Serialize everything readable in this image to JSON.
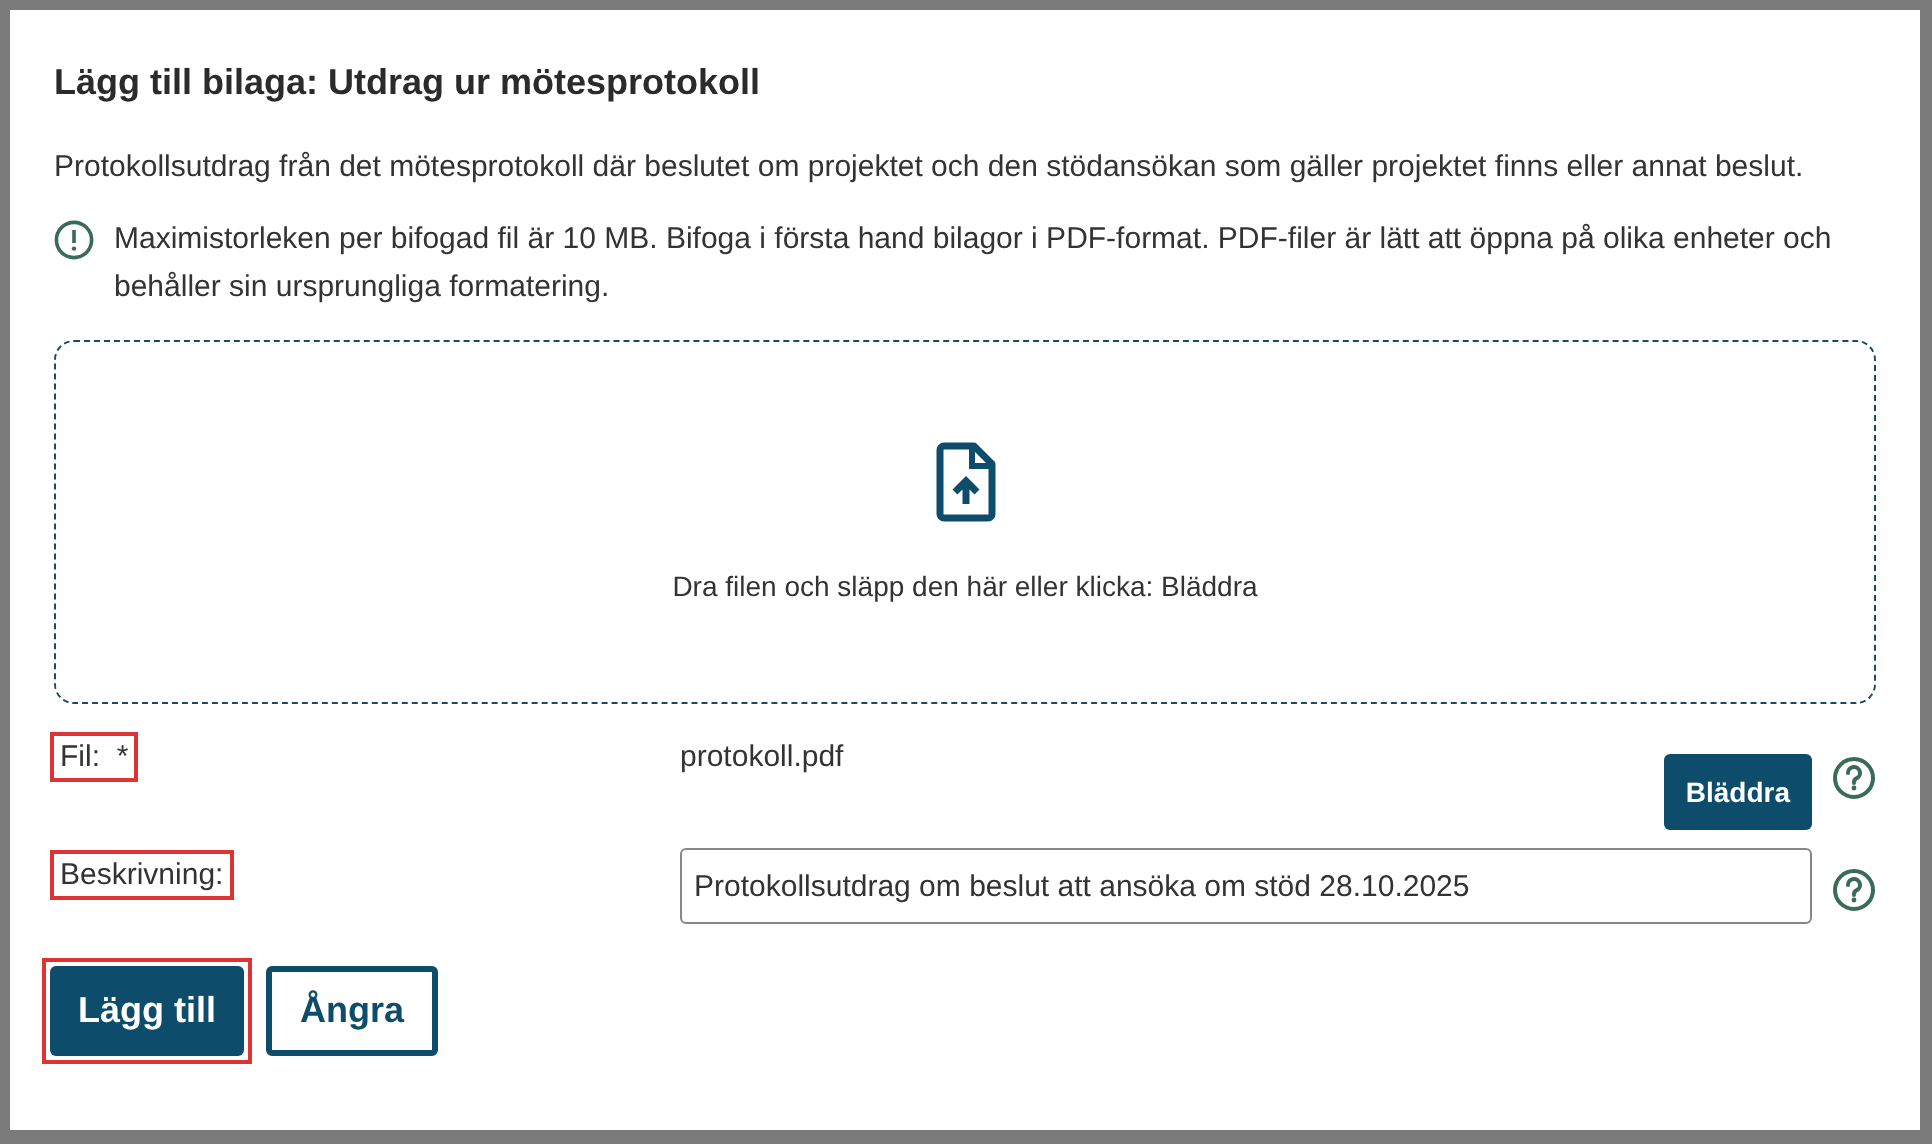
{
  "dialog": {
    "title": "Lägg till bilaga: Utdrag ur mötesprotokoll",
    "description": "Protokollsutdrag från det mötesprotokoll där beslutet om projektet och den stödansökan som gäller projektet finns eller annat beslut.",
    "notice": "Maximistorleken per bifogad fil är 10 MB. Bifoga i första hand bilagor i PDF-format. PDF-filer är lätt att öppna på olika enheter och behåller sin ursprungliga formatering.",
    "dropzone": {
      "text": "Dra filen och släpp den här eller klicka: Bläddra"
    },
    "fields": [
      {
        "kind": "file",
        "label": "Fil:",
        "required_mark": "*",
        "highlighted": true,
        "value": "protokoll.pdf",
        "button": "Bläddra"
      },
      {
        "kind": "text",
        "label": "Beskrivning:",
        "highlighted": true,
        "value": "Protokollsutdrag om beslut att ansöka om stöd 28.10.2025"
      }
    ],
    "buttons": [
      {
        "label": "Lägg till",
        "primary": true,
        "highlighted": true
      },
      {
        "label": "Ångra",
        "primary": false,
        "highlighted": false
      }
    ]
  }
}
